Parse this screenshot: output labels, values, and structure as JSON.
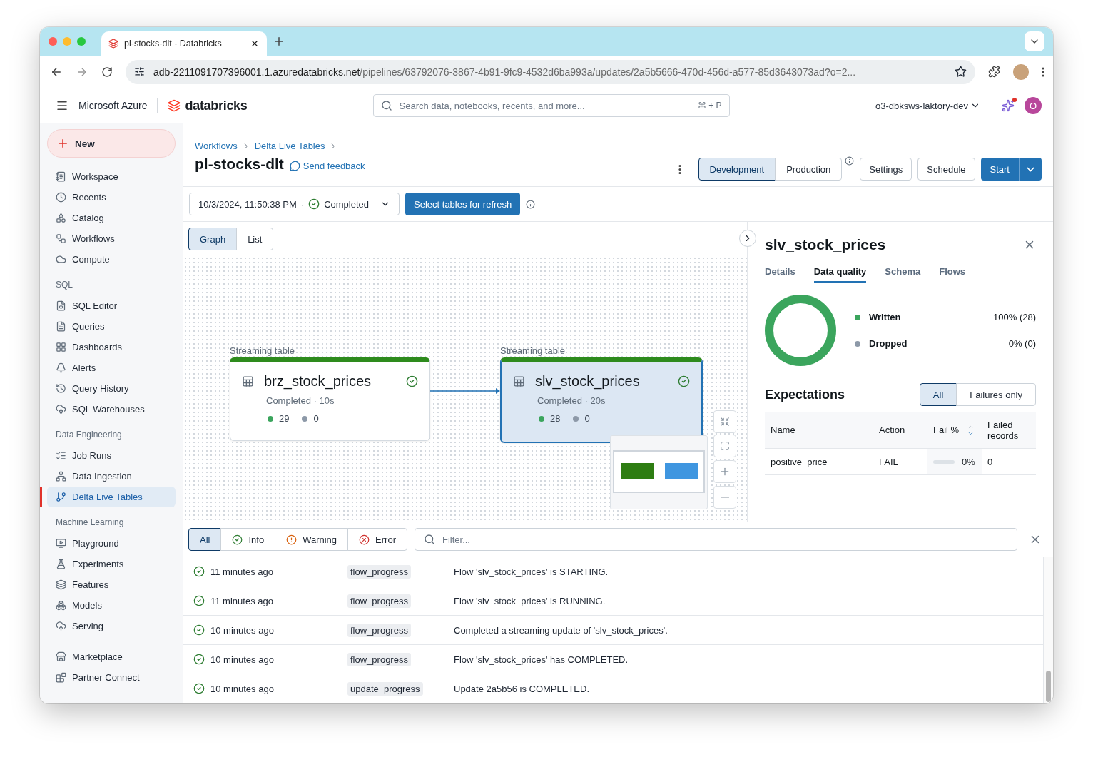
{
  "browser": {
    "tabs": [
      {
        "title": "pl-stocks-dlt - Databricks",
        "selected": true
      }
    ],
    "url_host": "adb-2211091707396001.1.azuredatabricks.net",
    "url_path": "/pipelines/63792076-3867-4b91-9fc9-4532d6ba993a/updates/2a5b5666-470d-456d-a577-85d3643073ad?o=2..."
  },
  "header": {
    "cloud": "Microsoft Azure",
    "brand": "databricks",
    "search_placeholder": "Search data, notebooks, recents, and more...",
    "shortcut": "⌘ + P",
    "workspace": "o3-dbksws-laktory-dev",
    "avatar": "O"
  },
  "sidebar": {
    "new_label": "New",
    "sections": [
      {
        "items": [
          {
            "label": "Workspace",
            "selected": false
          },
          {
            "label": "Recents",
            "selected": false
          },
          {
            "label": "Catalog",
            "selected": false
          },
          {
            "label": "Workflows",
            "selected": false
          },
          {
            "label": "Compute",
            "selected": false
          }
        ]
      },
      {
        "title": "SQL",
        "items": [
          {
            "label": "SQL Editor",
            "selected": false
          },
          {
            "label": "Queries",
            "selected": false
          },
          {
            "label": "Dashboards",
            "selected": false
          },
          {
            "label": "Alerts",
            "selected": false
          },
          {
            "label": "Query History",
            "selected": false
          },
          {
            "label": "SQL Warehouses",
            "selected": false
          }
        ]
      },
      {
        "title": "Data Engineering",
        "items": [
          {
            "label": "Job Runs",
            "selected": false
          },
          {
            "label": "Data Ingestion",
            "selected": false
          },
          {
            "label": "Delta Live Tables",
            "selected": true
          }
        ]
      },
      {
        "title": "Machine Learning",
        "items": [
          {
            "label": "Playground",
            "selected": false
          },
          {
            "label": "Experiments",
            "selected": false
          },
          {
            "label": "Features",
            "selected": false
          },
          {
            "label": "Models",
            "selected": false
          },
          {
            "label": "Serving",
            "selected": false
          }
        ]
      },
      {
        "items": [
          {
            "label": "Marketplace",
            "selected": false
          },
          {
            "label": "Partner Connect",
            "selected": false
          }
        ]
      }
    ]
  },
  "page": {
    "breadcrumbs": [
      "Workflows",
      "Delta Live Tables"
    ],
    "title": "pl-stocks-dlt",
    "feedback": "Send feedback",
    "modes": [
      {
        "label": "Development",
        "selected": true
      },
      {
        "label": "Production",
        "selected": false
      }
    ],
    "buttons": [
      "Settings",
      "Schedule"
    ],
    "start": "Start"
  },
  "update": {
    "timestamp": "10/3/2024, 11:50:38 PM",
    "separator": "·",
    "status": "Completed",
    "refresh": "Select tables for refresh"
  },
  "views": [
    {
      "label": "Graph",
      "selected": true
    },
    {
      "label": "List",
      "selected": false
    }
  ],
  "graph": {
    "nodes": [
      {
        "type": "Streaming table",
        "name": "brz_stock_prices",
        "status": "Completed · 10s",
        "written": "29",
        "dropped": "0",
        "selected": false
      },
      {
        "type": "Streaming table",
        "name": "slv_stock_prices",
        "status": "Completed · 20s",
        "written": "28",
        "dropped": "0",
        "selected": true
      }
    ]
  },
  "details": {
    "title": "slv_stock_prices",
    "tabs": [
      {
        "label": "Details",
        "selected": false
      },
      {
        "label": "Data quality",
        "selected": true
      },
      {
        "label": "Schema",
        "selected": false
      },
      {
        "label": "Flows",
        "selected": false
      }
    ],
    "legend": [
      {
        "label": "Written",
        "value": "100% (28)",
        "color": "#3ba55d"
      },
      {
        "label": "Dropped",
        "value": "0% (0)",
        "color": "#8d99a8"
      }
    ],
    "expectations": {
      "title": "Expectations",
      "filters": [
        {
          "label": "All",
          "selected": true
        },
        {
          "label": "Failures only",
          "selected": false
        }
      ],
      "columns": [
        "Name",
        "Action",
        "Fail %",
        "Failed records"
      ],
      "rows": [
        {
          "name": "positive_price",
          "action": "FAIL",
          "level": 0,
          "fail": "0%",
          "failed_records": "0"
        }
      ]
    }
  },
  "events": {
    "filters": [
      {
        "label": "All",
        "kind": "all",
        "selected": true
      },
      {
        "label": "Info",
        "kind": "info",
        "selected": false
      },
      {
        "label": "Warning",
        "kind": "warning",
        "selected": false
      },
      {
        "label": "Error",
        "kind": "error",
        "selected": false
      }
    ],
    "filter_placeholder": "Filter...",
    "rows": [
      {
        "time": "11 minutes ago",
        "type": "flow_progress",
        "message": "Flow 'slv_stock_prices' is STARTING."
      },
      {
        "time": "11 minutes ago",
        "type": "flow_progress",
        "message": "Flow 'slv_stock_prices' is RUNNING."
      },
      {
        "time": "10 minutes ago",
        "type": "flow_progress",
        "message": "Completed a streaming update of 'slv_stock_prices'."
      },
      {
        "time": "10 minutes ago",
        "type": "flow_progress",
        "message": "Flow 'slv_stock_prices' has COMPLETED."
      },
      {
        "time": "10 minutes ago",
        "type": "update_progress",
        "message": "Update 2a5b56 is COMPLETED."
      }
    ]
  }
}
